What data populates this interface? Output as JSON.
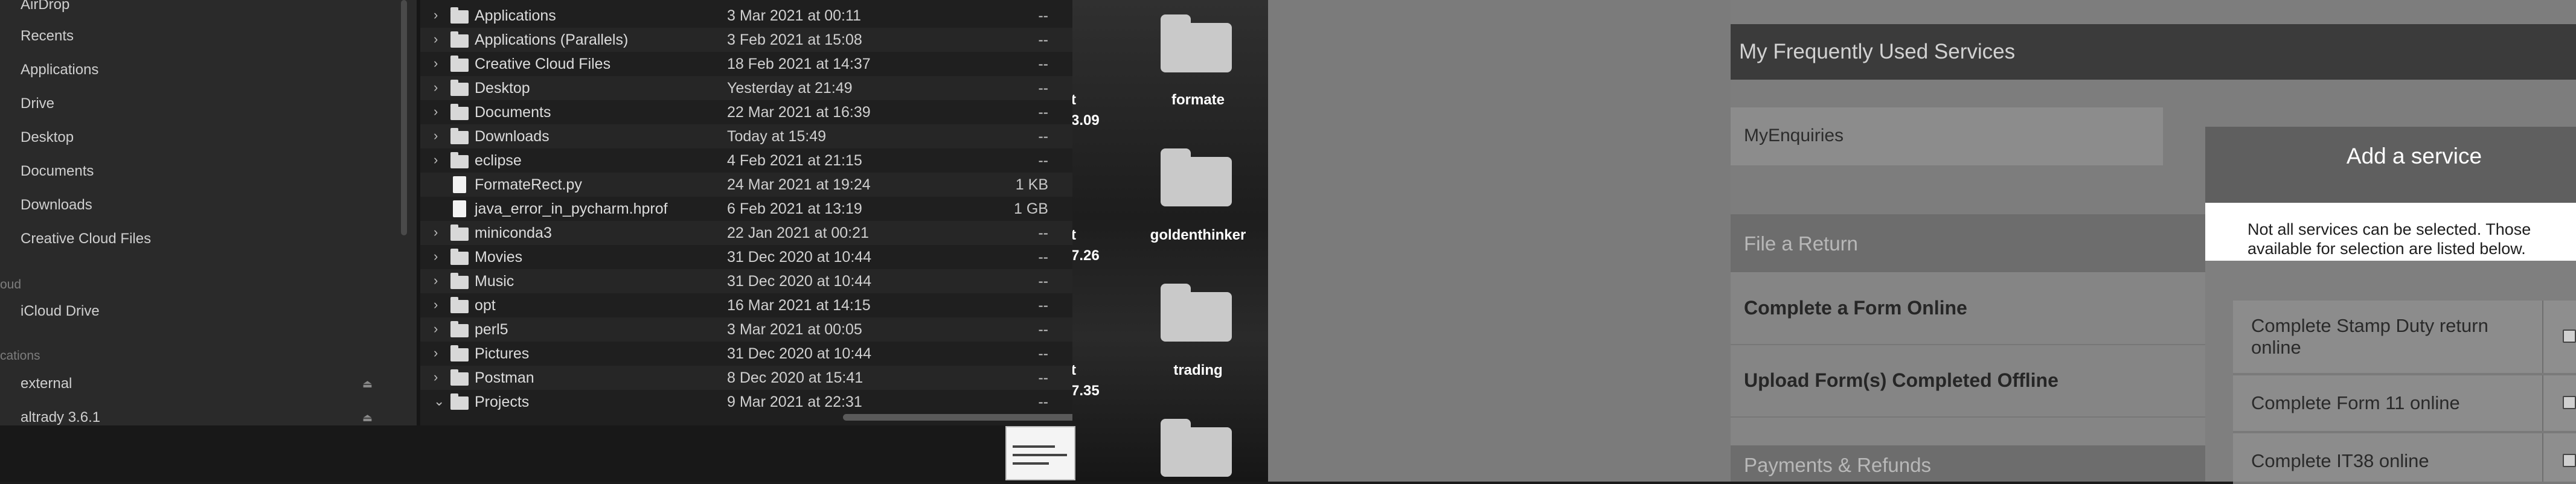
{
  "sidebar": {
    "items": [
      {
        "label": "AirDrop",
        "icon": "airdrop-icon"
      },
      {
        "label": "Recents",
        "icon": "clock-icon"
      },
      {
        "label": "Applications",
        "icon": "applications-icon"
      },
      {
        "label": "Drive",
        "icon": "drive-icon"
      },
      {
        "label": "Desktop",
        "icon": "desktop-icon"
      },
      {
        "label": "Documents",
        "icon": "document-icon"
      },
      {
        "label": "Downloads",
        "icon": "download-icon"
      },
      {
        "label": "Creative Cloud Files",
        "icon": "creative-cloud-icon"
      }
    ],
    "icloud_header": "oud",
    "icloud_item": "iCloud Drive",
    "locations_header": "cations",
    "locations": [
      "external",
      "altrady 3.6.1"
    ],
    "eject_glyph": "⏏"
  },
  "files": [
    {
      "name": "Applications",
      "date": "3 Mar 2021 at 00:11",
      "size": "--",
      "kind": "folder",
      "chevron": "›"
    },
    {
      "name": "Applications (Parallels)",
      "date": "3 Feb 2021 at 15:08",
      "size": "--",
      "kind": "folder",
      "chevron": "›"
    },
    {
      "name": "Creative Cloud Files",
      "date": "18 Feb 2021 at 14:37",
      "size": "--",
      "kind": "folder",
      "chevron": "›"
    },
    {
      "name": "Desktop",
      "date": "Yesterday at 21:49",
      "size": "--",
      "kind": "folder",
      "chevron": "›"
    },
    {
      "name": "Documents",
      "date": "22 Mar 2021 at 16:39",
      "size": "--",
      "kind": "folder",
      "chevron": "›"
    },
    {
      "name": "Downloads",
      "date": "Today at 15:49",
      "size": "--",
      "kind": "folder",
      "chevron": "›"
    },
    {
      "name": "eclipse",
      "date": "4 Feb 2021 at 21:15",
      "size": "--",
      "kind": "folder",
      "chevron": "›"
    },
    {
      "name": "FormateRect.py",
      "date": "24 Mar 2021 at 19:24",
      "size": "1 KB",
      "kind": "file",
      "chevron": ""
    },
    {
      "name": "java_error_in_pycharm.hprof",
      "date": "6 Feb 2021 at 13:19",
      "size": "1 GB",
      "kind": "file",
      "chevron": ""
    },
    {
      "name": "miniconda3",
      "date": "22 Jan 2021 at 00:21",
      "size": "--",
      "kind": "folder",
      "chevron": "›"
    },
    {
      "name": "Movies",
      "date": "31 Dec 2020 at 10:44",
      "size": "--",
      "kind": "folder",
      "chevron": "›"
    },
    {
      "name": "Music",
      "date": "31 Dec 2020 at 10:44",
      "size": "--",
      "kind": "folder",
      "chevron": "›"
    },
    {
      "name": "opt",
      "date": "16 Mar 2021 at 14:15",
      "size": "--",
      "kind": "folder",
      "chevron": "›"
    },
    {
      "name": "perl5",
      "date": "3 Mar 2021 at 00:05",
      "size": "--",
      "kind": "folder",
      "chevron": "›"
    },
    {
      "name": "Pictures",
      "date": "31 Dec 2020 at 10:44",
      "size": "--",
      "kind": "folder",
      "chevron": "›"
    },
    {
      "name": "Postman",
      "date": "8 Dec 2020 at 15:41",
      "size": "--",
      "kind": "folder",
      "chevron": "›"
    },
    {
      "name": "Projects",
      "date": "9 Mar 2021 at 22:31",
      "size": "--",
      "kind": "folder",
      "chevron": "⌄"
    }
  ],
  "desktop": {
    "folders": [
      "formate",
      "goldenthinker",
      "trading"
    ],
    "partial_labels": [
      {
        "top": "t",
        "bottom": "3.09"
      },
      {
        "top": "t",
        "bottom": "7.26"
      },
      {
        "top": "t",
        "bottom": "7.35"
      }
    ]
  },
  "portal": {
    "section_title": "My Frequently Used Services",
    "enquiries": "MyEnquiries",
    "file_return_header": "File a Return",
    "file_links": [
      "Complete a Form Online",
      "Upload Form(s) Completed Offline"
    ],
    "payments_header": "Payments & Refunds"
  },
  "modal": {
    "title": "Add a service",
    "note": "Not all services can be selected. Those available for selection are listed below.",
    "services": [
      "Complete Stamp Duty return online",
      "Complete Form 11 online",
      "Complete IT38 online"
    ]
  }
}
